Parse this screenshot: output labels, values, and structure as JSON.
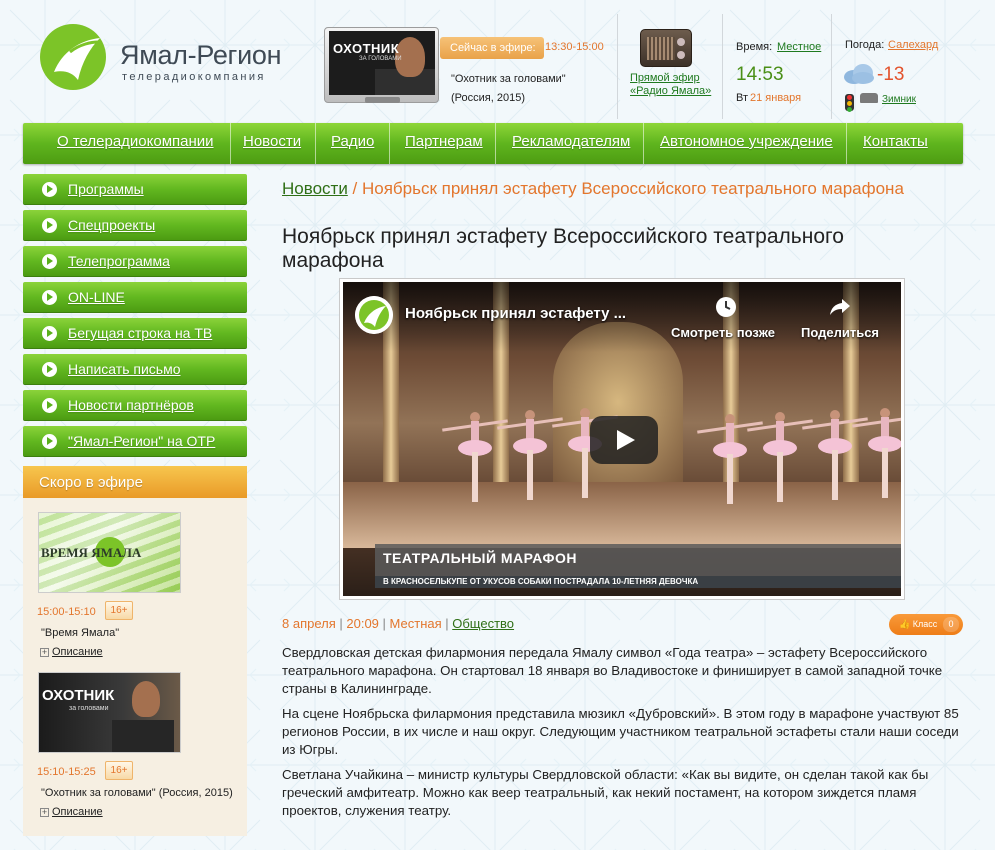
{
  "brand": {
    "title": "Ямал-Регион",
    "subtitle": "телерадиокомпания"
  },
  "onair": {
    "tv_title": "ОХОТНИК",
    "tv_subtitle": "ЗА ГОЛОВАМИ",
    "label": "Сейчас в эфире:",
    "time": "13:30-15:00",
    "program": "\"Охотник за головами\"",
    "meta": "(Россия, 2015)"
  },
  "radio": {
    "link": "Прямой эфир «Радио Ямала»"
  },
  "clock": {
    "label": "Время:",
    "zone": "Местное",
    "time": "14:53",
    "day": "Вт",
    "date": "21 января"
  },
  "weather": {
    "label": "Погода:",
    "city": "Салехард",
    "temp": "-13",
    "road": "Зимник",
    "icon": "cloud-icon",
    "traffic_icon": "traffic-light-icon"
  },
  "nav": {
    "items": [
      "О телерадиокомпании",
      "Новости",
      "Радио",
      "Партнерам",
      "Рекламодателям",
      "Автономное учреждение",
      "Контакты"
    ]
  },
  "sidebar": {
    "items": [
      "Программы",
      "Спецпроекты",
      "Телепрограмма",
      "ON-LINE",
      "Бегущая строка на ТВ",
      "Написать письмо",
      "Новости партнёров",
      "\"Ямал-Регион\" на ОТР"
    ]
  },
  "soon": {
    "title": "Скоро в эфире",
    "items": [
      {
        "thumb_text": "ВРЕМЯ ЯМАЛА",
        "time": "15:00-15:10",
        "age": "16+",
        "name": "\"Время Ямала\"",
        "desc": "Описание"
      },
      {
        "thumb_text": "ОХОТНИК",
        "thumb_sub": "за головами",
        "time": "15:10-15:25",
        "age": "16+",
        "name": "\"Охотник за головами\" (Россия, 2015)",
        "desc": "Описание"
      }
    ]
  },
  "breadcrumb": {
    "root": "Новости",
    "sep": " / ",
    "current": "Ноябрьск принял эстафету Всероссийского театрального марафона"
  },
  "article": {
    "title": "Ноябрьск принял эстафету Всероссийского театрального марафона",
    "video": {
      "title": "Ноябрьск принял эстафету ...",
      "watch_later": "Смотреть позже",
      "share": "Поделиться",
      "banner": "ТЕАТРАЛЬНЫЙ МАРАФОН",
      "ticker": "В КРАСНОСЕЛЬКУПЕ ОТ УКУСОВ СОБАКИ ПОСТРАДАЛА 10-ЛЕТНЯЯ ДЕВОЧКА"
    },
    "meta": {
      "date": "8 апреля",
      "time": "20:09",
      "region": "Местная",
      "category": "Общество",
      "sep": " | "
    },
    "share": {
      "label": "Класс",
      "count": "0"
    },
    "paragraphs": [
      "Свердловская детская филармония передала Ямалу символ «Года театра» – эстафету Всероссийского театрального марафона. Он стартовал 18 января во Владивостоке и финиширует в самой западной точке страны в Калининграде.",
      "На сцене Ноябрьска филармония представила мюзикл «Дубровский». В этом году в марафоне участвуют 85 регионов России, в их числе и наш округ. Следующим участником театральной эстафеты стали наши соседи из Югры.",
      "Светлана Учайкина – министр культуры Свердловской области: «Как вы видите, он сделан такой как бы греческий амфитеатр. Можно как веер театральный, как некий постамент, на котором зиждется пламя проектов, служения театру."
    ]
  },
  "colors": {
    "green": "#5fb51e",
    "orange": "#e3762d",
    "link_green": "#2f6f16"
  }
}
